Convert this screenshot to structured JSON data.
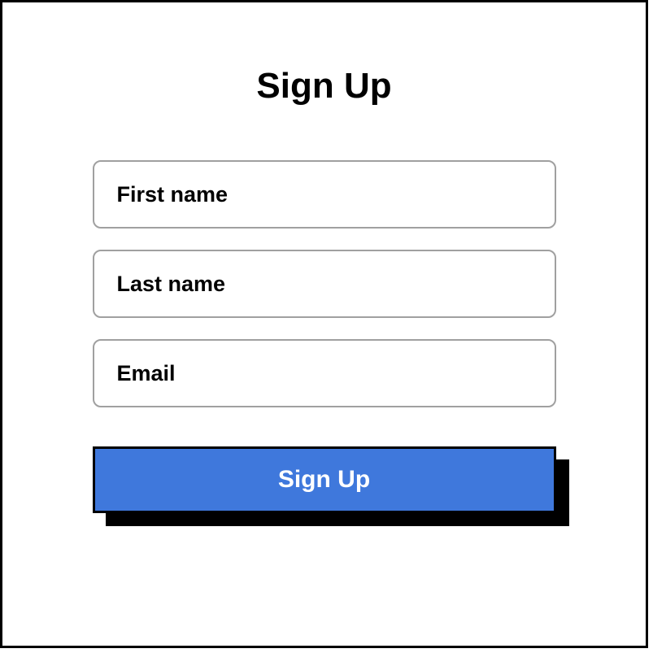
{
  "form": {
    "title": "Sign Up",
    "fields": {
      "first_name": {
        "placeholder": "First name",
        "value": ""
      },
      "last_name": {
        "placeholder": "Last name",
        "value": ""
      },
      "email": {
        "placeholder": "Email",
        "value": ""
      }
    },
    "submit_label": "Sign Up"
  },
  "colors": {
    "button_bg": "#3F78DC",
    "border": "#000000",
    "input_border": "#a0a0a0"
  }
}
